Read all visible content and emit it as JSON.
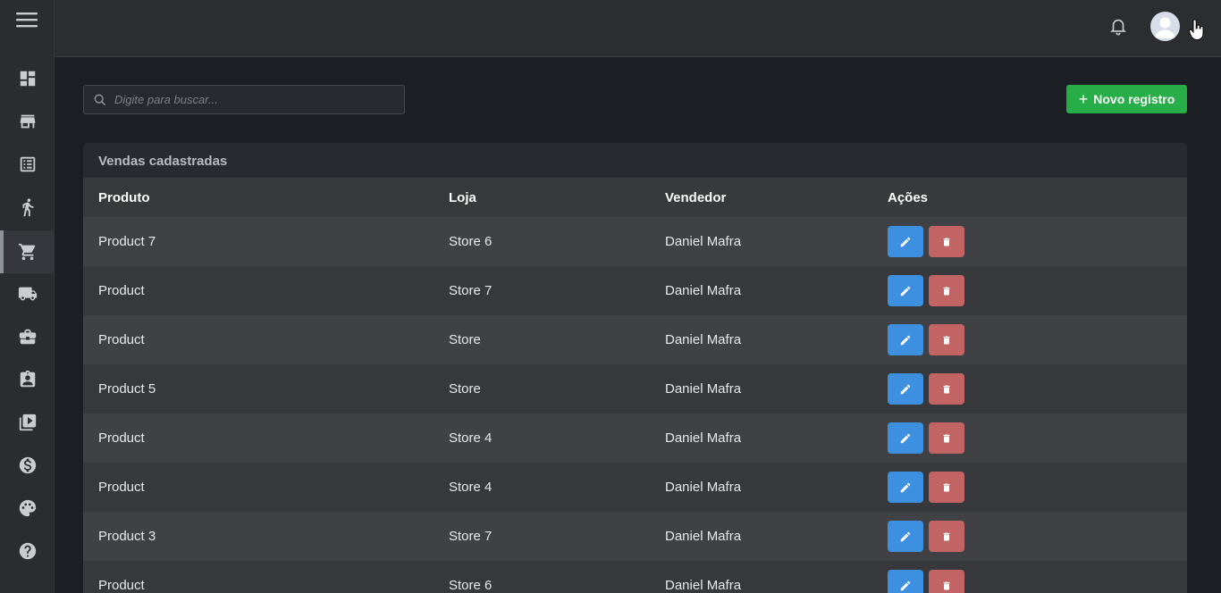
{
  "sidebar": {
    "items": [
      {
        "icon": "dashboard-icon",
        "active": false
      },
      {
        "icon": "store-icon",
        "active": false
      },
      {
        "icon": "list-icon",
        "active": false
      },
      {
        "icon": "person-walking-icon",
        "active": false
      },
      {
        "icon": "shopping-cart-icon",
        "active": true
      },
      {
        "icon": "truck-icon",
        "active": false
      },
      {
        "icon": "briefcase-icon",
        "active": false
      },
      {
        "icon": "badge-icon",
        "active": false
      },
      {
        "icon": "video-library-icon",
        "active": false
      },
      {
        "icon": "dollar-icon",
        "active": false
      },
      {
        "icon": "palette-icon",
        "active": false
      },
      {
        "icon": "help-icon",
        "active": false
      }
    ]
  },
  "search": {
    "placeholder": "Digite para buscar..."
  },
  "toolbar": {
    "new_label": "Novo registro"
  },
  "card": {
    "title": "Vendas cadastradas"
  },
  "table": {
    "headers": {
      "product": "Produto",
      "store": "Loja",
      "seller": "Vendedor",
      "actions": "Ações"
    },
    "rows": [
      {
        "product": "Product 7",
        "store": "Store 6",
        "seller": "Daniel Mafra"
      },
      {
        "product": "Product",
        "store": "Store 7",
        "seller": "Daniel Mafra"
      },
      {
        "product": "Product",
        "store": "Store",
        "seller": "Daniel Mafra"
      },
      {
        "product": "Product 5",
        "store": "Store",
        "seller": "Daniel Mafra"
      },
      {
        "product": "Product",
        "store": "Store 4",
        "seller": "Daniel Mafra"
      },
      {
        "product": "Product",
        "store": "Store 4",
        "seller": "Daniel Mafra"
      },
      {
        "product": "Product 3",
        "store": "Store 7",
        "seller": "Daniel Mafra"
      },
      {
        "product": "Product",
        "store": "Store 6",
        "seller": "Daniel Mafra"
      }
    ]
  },
  "colors": {
    "accent_green": "#27ae48",
    "edit_blue": "#3d8fdf",
    "delete_red": "#c26464"
  }
}
